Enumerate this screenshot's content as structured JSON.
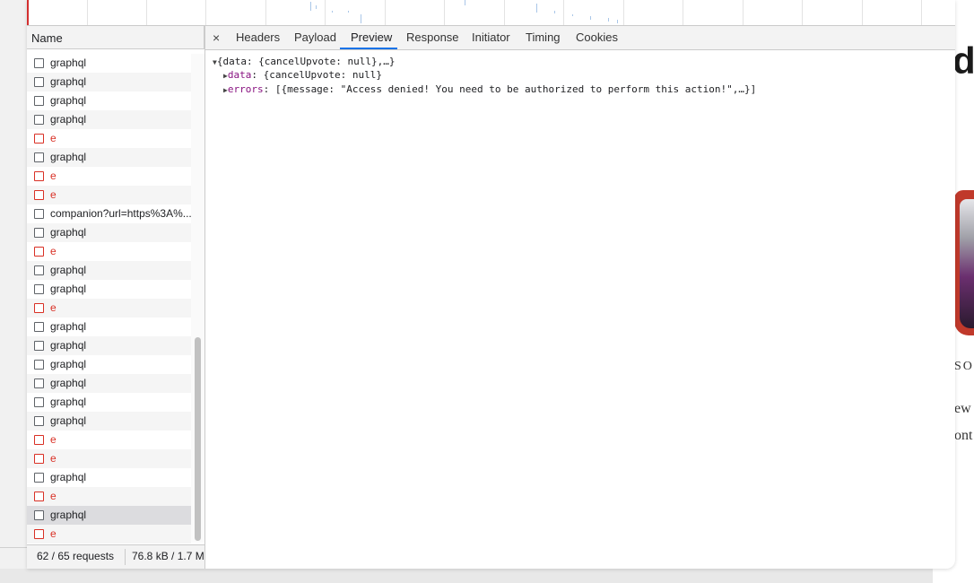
{
  "overview": {},
  "request_list": {
    "column_header": "Name",
    "requests": [
      {
        "name": "graphql",
        "error": false
      },
      {
        "name": "graphql",
        "error": false
      },
      {
        "name": "graphql",
        "error": false
      },
      {
        "name": "graphql",
        "error": false
      },
      {
        "name": "e",
        "error": true
      },
      {
        "name": "graphql",
        "error": false
      },
      {
        "name": "e",
        "error": true
      },
      {
        "name": "e",
        "error": true
      },
      {
        "name": "companion?url=https%3A%...",
        "error": false
      },
      {
        "name": "graphql",
        "error": false
      },
      {
        "name": "e",
        "error": true
      },
      {
        "name": "graphql",
        "error": false
      },
      {
        "name": "graphql",
        "error": false
      },
      {
        "name": "e",
        "error": true
      },
      {
        "name": "graphql",
        "error": false
      },
      {
        "name": "graphql",
        "error": false
      },
      {
        "name": "graphql",
        "error": false
      },
      {
        "name": "graphql",
        "error": false
      },
      {
        "name": "graphql",
        "error": false
      },
      {
        "name": "graphql",
        "error": false
      },
      {
        "name": "e",
        "error": true
      },
      {
        "name": "e",
        "error": true
      },
      {
        "name": "graphql",
        "error": false
      },
      {
        "name": "e",
        "error": true
      },
      {
        "name": "graphql",
        "error": false,
        "selected": true
      },
      {
        "name": "e",
        "error": true
      }
    ],
    "status": {
      "requests": "62 / 65 requests",
      "transferred": "76.8 kB / 1.7 M"
    }
  },
  "detail": {
    "close_icon": "×",
    "tabs": [
      "Headers",
      "Payload",
      "Preview",
      "Response",
      "Initiator",
      "Timing",
      "Cookies"
    ],
    "active_tab": "Preview",
    "preview": {
      "root": "{data: {cancelUpvote: null},…}",
      "lines": [
        {
          "key": "data",
          "value": "{cancelUpvote: null}"
        },
        {
          "key": "errors",
          "value": "[{message: \"Access denied! You need to be authorized to perform this action!\",…}]"
        }
      ]
    }
  },
  "background_page": {
    "heading_fragment": "d",
    "text_fragments": [
      "SOU",
      "ew",
      "ont"
    ]
  },
  "colors": {
    "error": "#d93025",
    "accent": "#1a73e8",
    "key": "#881280",
    "selected_row": "#dcdcdf"
  }
}
